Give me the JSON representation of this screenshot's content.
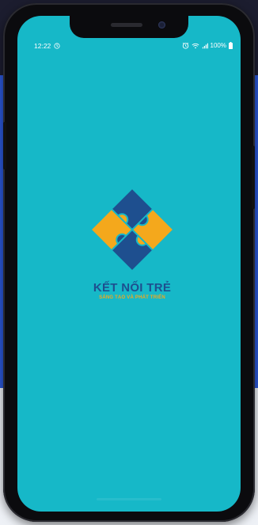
{
  "status_bar": {
    "time": "12:22",
    "battery_percent": "100%",
    "icons": [
      "alarm-icon",
      "wifi-icon",
      "signal-icon",
      "battery-icon"
    ]
  },
  "splash": {
    "app_name": "KẾT NỐI TRẺ",
    "tagline": "SÁNG TẠO VÀ PHÁT TRIỂN",
    "logo": "puzzle-diamond-logo"
  },
  "colors": {
    "screen_background": "#16b8c8",
    "brand_blue": "#1e4f8f",
    "brand_orange": "#f4a81c",
    "backdrop_blue": "#2b57d8"
  }
}
